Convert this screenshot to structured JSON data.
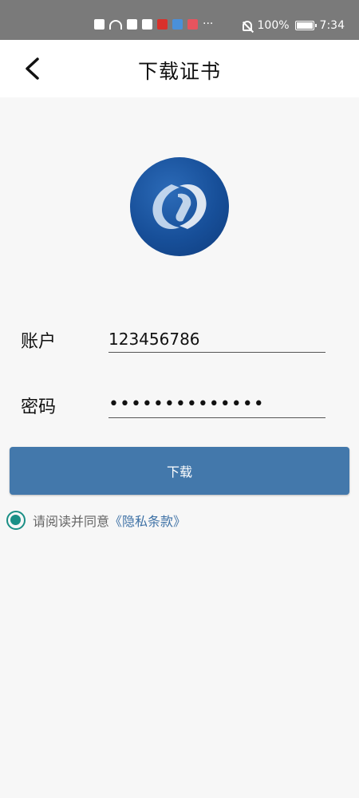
{
  "status_bar": {
    "battery": "100%",
    "time": "7:34",
    "more": "···"
  },
  "header": {
    "title": "下载证书"
  },
  "form": {
    "account_label": "账户",
    "account_value": "123456786",
    "password_label": "密码",
    "password_value": "••••••••••••••"
  },
  "actions": {
    "download_label": "下载"
  },
  "agreement": {
    "text": "请阅读并同意",
    "link": "《隐私条款》",
    "checked": true
  },
  "colors": {
    "button": "#4378ab",
    "radio": "#1a8f86",
    "link": "#3f72a6"
  }
}
